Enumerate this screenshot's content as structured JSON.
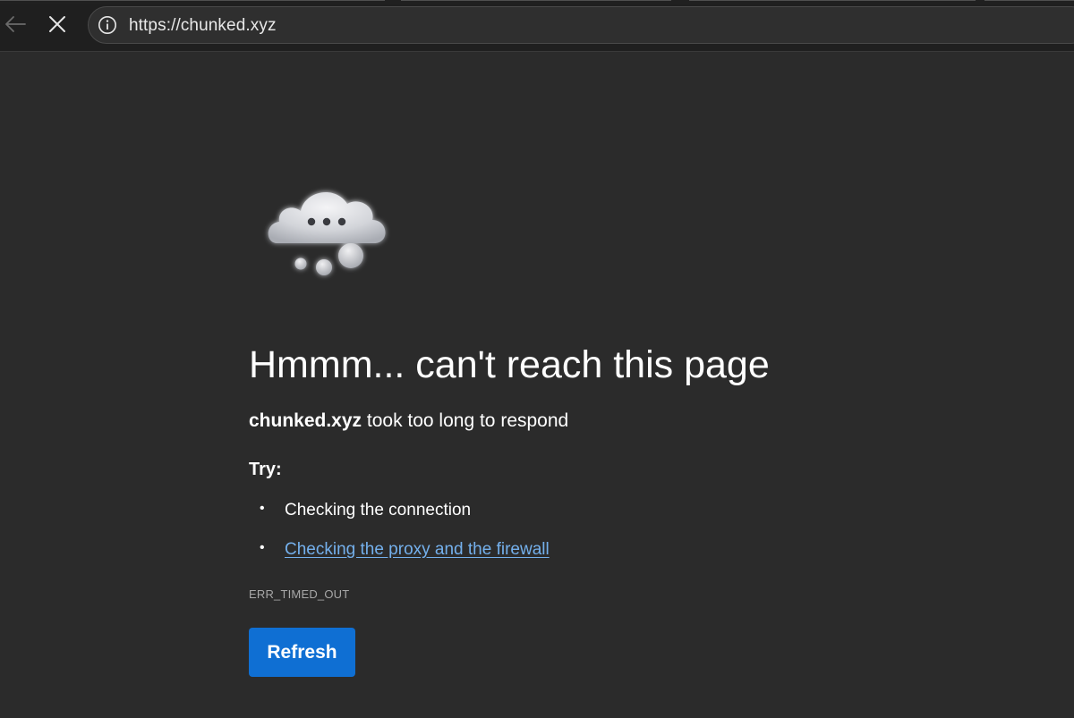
{
  "browser": {
    "url": "https://chunked.xyz",
    "icons": {
      "back": "back-arrow-icon",
      "stop": "close-icon",
      "site_info": "info-icon"
    }
  },
  "error_page": {
    "illustration": "cloud-thinking-icon",
    "headline": "Hmmm... can't reach this page",
    "host": "chunked.xyz",
    "reason": " took too long to respond",
    "try_label": "Try:",
    "suggestions": [
      {
        "text": "Checking the connection",
        "is_link": false
      },
      {
        "text": "Checking the proxy and the firewall",
        "is_link": true
      }
    ],
    "error_code": "ERR_TIMED_OUT",
    "refresh_label": "Refresh"
  },
  "colors": {
    "page_background": "#2b2b2b",
    "toolbar_background": "#1f1f1f",
    "link": "#74b0ec",
    "primary_button": "#0f6fd3"
  }
}
